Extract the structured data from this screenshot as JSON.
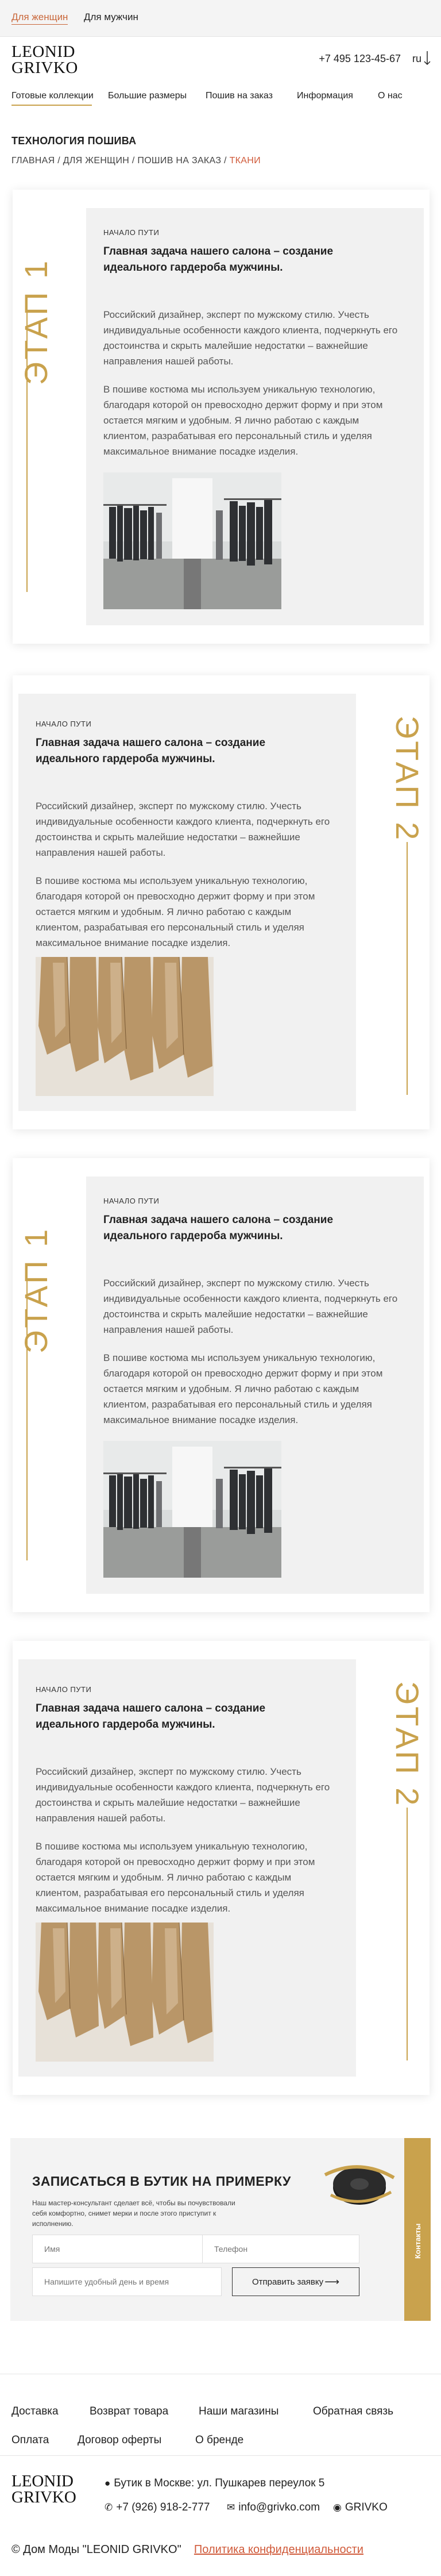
{
  "gender_tabs": [
    {
      "label": "Для женщин",
      "active": true
    },
    {
      "label": "Для мужчин",
      "active": false
    }
  ],
  "header": {
    "logo_line1": "LEONID",
    "logo_line2": "GRIVKO",
    "phone": "+7 495 123-45-67",
    "lang": "ru"
  },
  "nav": {
    "items": [
      "Готовые коллекции",
      "Большие размеры",
      "Пошив на заказ",
      "Информация",
      "О нас"
    ]
  },
  "page_title": "ТЕХНОЛОГИЯ ПОШИВА",
  "breadcrumb": {
    "items": [
      "ГЛАВНАЯ",
      "ДЛЯ ЖЕНЩИН",
      "ПОШИВ НА ЗАКАЗ"
    ],
    "separator": " / ",
    "current": "ТКАНИ"
  },
  "stages": [
    {
      "label": "ЭТАП 1",
      "kicker": "НАЧАЛО ПУТИ",
      "title": "Главная задача нашего салона – создание идеального гардероба мужчины.",
      "para1": "Российский дизайнер, эксперт по мужскому стилю. Учесть индивидуальные особенности каждого клиента, подчеркнуть его достоинства и скрыть малейшие недостатки – важнейшие направления нашей работы.",
      "para2": "В пошиве костюма мы используем уникальную технологию, благодаря которой он превосходно держит форму и при этом остается мягким и удобным. Я лично работаю с каждым клиентом, разрабатывая его персональный стиль и уделяя максимальное внимание посадке изделия.",
      "photo": "boutique-interior"
    },
    {
      "label": "ЭТАП 2",
      "kicker": "НАЧАЛО ПУТИ",
      "title": "Главная задача нашего салона – создание идеального гардероба мужчины.",
      "para1": "Российский дизайнер, эксперт по мужскому стилю. Учесть индивидуальные особенности каждого клиента, подчеркнуть его достоинства и скрыть малейшие недостатки – важнейшие направления нашей работы.",
      "para2": "В пошиве костюма мы используем уникальную технологию, благодаря которой он превосходно держит форму и при этом остается мягким и удобным. Я лично работаю с каждым клиентом, разрабатывая его персональный стиль и уделяя максимальное внимание посадке изделия.",
      "photo": "paper-patterns"
    },
    {
      "label": "ЭТАП 1",
      "kicker": "НАЧАЛО ПУТИ",
      "title": "Главная задача нашего салона – создание идеального гардероба мужчины.",
      "para1": "Российский дизайнер, эксперт по мужскому стилю. Учесть индивидуальные особенности каждого клиента, подчеркнуть его достоинства и скрыть малейшие недостатки – важнейшие направления нашей работы.",
      "para2": "В пошиве костюма мы используем уникальную технологию, благодаря которой он превосходно держит форму и при этом остается мягким и удобным. Я лично работаю с каждым клиентом, разрабатывая его персональный стиль и уделяя максимальное внимание посадке изделия.",
      "photo": "boutique-interior"
    },
    {
      "label": "ЭТАП 2",
      "kicker": "НАЧАЛО ПУТИ",
      "title": "Главная задача нашего салона – создание идеального гардероба мужчины.",
      "para1": "Российский дизайнер, эксперт по мужскому стилю. Учесть индивидуальные особенности каждого клиента, подчеркнуть его достоинства и скрыть малейшие недостатки – важнейшие направления нашей работы.",
      "para2": "В пошиве костюма мы используем уникальную технологию, благодаря которой он превосходно держит форму и при этом остается мягким и удобным. Я лично работаю с каждым клиентом, разрабатывая его персональный стиль и уделяя максимальное внимание посадке изделия.",
      "photo": "paper-patterns"
    }
  ],
  "fitting": {
    "title": "ЗАПИСАТЬСЯ В БУТИК НА ПРИМЕРКУ",
    "description": "Наш мастер-консультант сделает всё, чтобы вы почувствовали себя комфортно, снимет мерки и после этого приступит к исполнению.",
    "name_placeholder": "Имя",
    "phone_placeholder": "Телефон",
    "time_placeholder": "Напишите удобный день и время",
    "submit_label": "Отправить заявку",
    "submit_arrow": "⟶",
    "side_label": "Контакты"
  },
  "footer": {
    "links_row1": [
      "Доставка",
      "Возврат товара",
      "Наши магазины",
      "Обратная связь"
    ],
    "links_row2": [
      "Оплата",
      "Договор оферты",
      "О бренде"
    ],
    "logo_line1": "LEONID",
    "logo_line2": "GRIVKO",
    "address": "Бутик в Москве: ул. Пушкарев переулок 5",
    "phone": "+7 (926) 918-2-777",
    "email": "info@grivko.com",
    "instagram": "GRIVKO",
    "copyright": "© Дом Моды \"LEONID GRIVKO\"",
    "privacy": "Политика конфиденциальности"
  },
  "colors": {
    "accent_gold": "#c9a24d",
    "accent_orange": "#d05a3a",
    "card_bg": "#f1f1f1"
  }
}
